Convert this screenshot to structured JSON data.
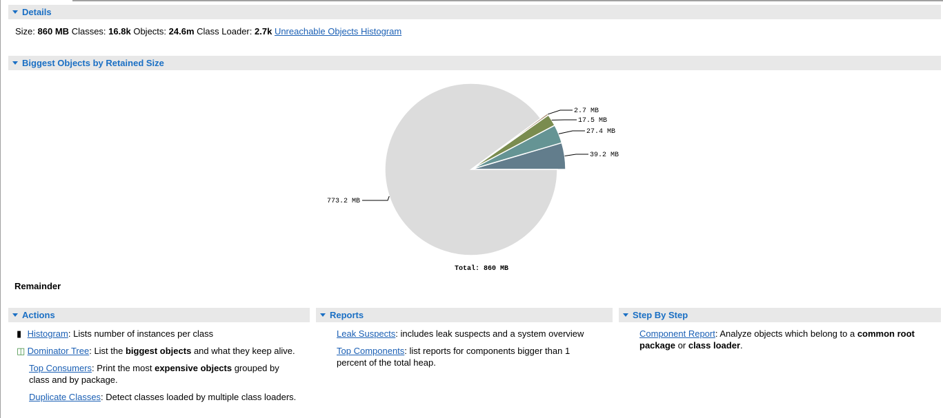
{
  "details": {
    "title": "Details",
    "size_label": "Size:",
    "size": "860 MB",
    "classes_label": "Classes:",
    "classes": "16.8k",
    "objects_label": "Objects:",
    "objects": "24.6m",
    "loader_label": "Class Loader:",
    "loader": "2.7k",
    "link": "Unreachable Objects Histogram"
  },
  "biggest": {
    "title": "Biggest Objects by Retained Size",
    "total": "Total: 860 MB",
    "remainder": "Remainder"
  },
  "chart_data": {
    "type": "pie",
    "unit": "MB",
    "total": 860,
    "slices": [
      {
        "value": 39.2,
        "label": "39.2 MB",
        "color": "#627d8c"
      },
      {
        "value": 27.4,
        "label": "27.4 MB",
        "color": "#659494"
      },
      {
        "value": 17.5,
        "label": "17.5 MB",
        "color": "#7a8c4f"
      },
      {
        "value": 2.7,
        "label": "2.7 MB",
        "color": "#a08060"
      },
      {
        "value": 773.2,
        "label": "773.2 MB",
        "color": "#dcdcdc"
      }
    ]
  },
  "actions": {
    "title": "Actions",
    "items": [
      {
        "link": "Histogram",
        "t1": ": Lists number of instances per class"
      },
      {
        "link": "Dominator Tree",
        "t1": ": List the ",
        "b": "biggest objects",
        "t2": " and what they keep alive."
      },
      {
        "link": "Top Consumers",
        "t1": ": Print the most ",
        "b": "expensive objects",
        "t2": " grouped by class and by package."
      },
      {
        "link": "Duplicate Classes",
        "t1": ": Detect classes loaded by multiple class loaders."
      }
    ]
  },
  "reports": {
    "title": "Reports",
    "items": [
      {
        "link": "Leak Suspects",
        "t1": ": includes leak suspects and a system overview"
      },
      {
        "link": "Top Components",
        "t1": ": list reports for components bigger than 1 percent of the total heap."
      }
    ]
  },
  "steps": {
    "title": "Step By Step",
    "items": [
      {
        "link": "Component Report",
        "t1": ": Analyze objects which belong to a ",
        "b": "common root package",
        "t2": " or ",
        "b2": "class loader",
        "t3": "."
      }
    ]
  }
}
